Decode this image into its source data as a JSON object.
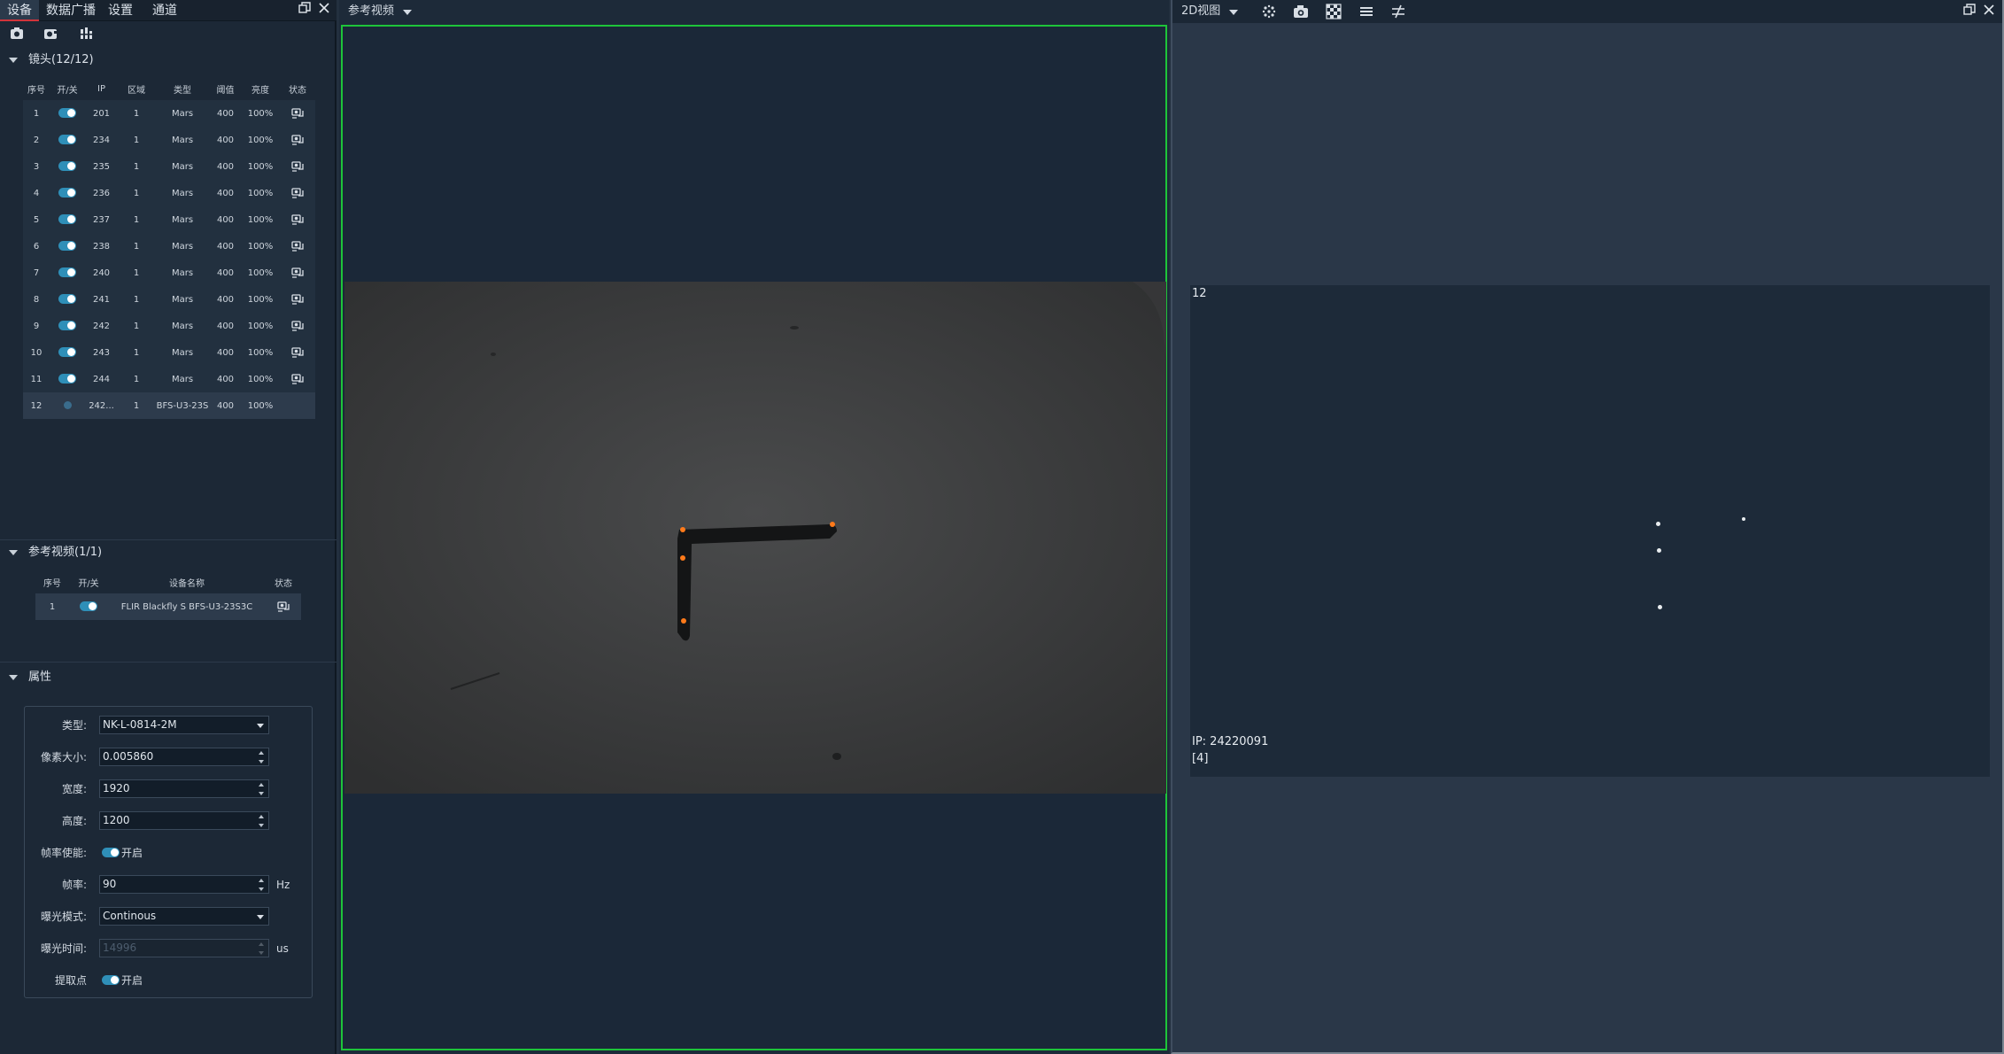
{
  "left_tabs": [
    "设备",
    "数据广播",
    "设置",
    "通道"
  ],
  "cameras": {
    "title": "镜头(12/12)",
    "columns": [
      "序号",
      "开/关",
      "IP",
      "区域",
      "类型",
      "阈值",
      "亮度",
      "状态"
    ],
    "rows": [
      {
        "no": "1",
        "on": true,
        "ip": "201",
        "zone": "1",
        "type": "Mars",
        "threshold": "400",
        "brightness": "100%",
        "status": "connected-icon"
      },
      {
        "no": "2",
        "on": true,
        "ip": "234",
        "zone": "1",
        "type": "Mars",
        "threshold": "400",
        "brightness": "100%",
        "status": "connected-icon"
      },
      {
        "no": "3",
        "on": true,
        "ip": "235",
        "zone": "1",
        "type": "Mars",
        "threshold": "400",
        "brightness": "100%",
        "status": "connected-icon"
      },
      {
        "no": "4",
        "on": true,
        "ip": "236",
        "zone": "1",
        "type": "Mars",
        "threshold": "400",
        "brightness": "100%",
        "status": "connected-icon"
      },
      {
        "no": "5",
        "on": true,
        "ip": "237",
        "zone": "1",
        "type": "Mars",
        "threshold": "400",
        "brightness": "100%",
        "status": "connected-icon"
      },
      {
        "no": "6",
        "on": true,
        "ip": "238",
        "zone": "1",
        "type": "Mars",
        "threshold": "400",
        "brightness": "100%",
        "status": "connected-icon"
      },
      {
        "no": "7",
        "on": true,
        "ip": "240",
        "zone": "1",
        "type": "Mars",
        "threshold": "400",
        "brightness": "100%",
        "status": "connected-icon"
      },
      {
        "no": "8",
        "on": true,
        "ip": "241",
        "zone": "1",
        "type": "Mars",
        "threshold": "400",
        "brightness": "100%",
        "status": "connected-icon"
      },
      {
        "no": "9",
        "on": true,
        "ip": "242",
        "zone": "1",
        "type": "Mars",
        "threshold": "400",
        "brightness": "100%",
        "status": "connected-icon"
      },
      {
        "no": "10",
        "on": true,
        "ip": "243",
        "zone": "1",
        "type": "Mars",
        "threshold": "400",
        "brightness": "100%",
        "status": "connected-icon"
      },
      {
        "no": "11",
        "on": true,
        "ip": "244",
        "zone": "1",
        "type": "Mars",
        "threshold": "400",
        "brightness": "100%",
        "status": "connected-icon"
      },
      {
        "no": "12",
        "on": false,
        "ip": "242...",
        "zone": "1",
        "type": "BFS-U3-23S",
        "threshold": "400",
        "brightness": "100%",
        "status": ""
      }
    ]
  },
  "ref_video_list": {
    "title": "参考视频(1/1)",
    "columns": [
      "序号",
      "开/关",
      "设备名称",
      "状态"
    ],
    "rows": [
      {
        "no": "1",
        "on": true,
        "name": "FLIR Blackfly S BFS-U3-23S3C",
        "status": "connected-icon"
      }
    ]
  },
  "properties": {
    "title": "属性",
    "type_label": "类型:",
    "type_value": "NK-L-0814-2M",
    "pixel_label": "像素大小:",
    "pixel_value": "0.005860",
    "width_label": "宽度:",
    "width_value": "1920",
    "height_label": "高度:",
    "height_value": "1200",
    "fps_enable_label": "帧率使能:",
    "fps_enable_text": "开启",
    "fps_label": "帧率:",
    "fps_value": "90",
    "fps_unit": "Hz",
    "exposure_mode_label": "曝光模式:",
    "exposure_mode_value": "Continous",
    "exposure_time_label": "曝光时间:",
    "exposure_time_value": "14996",
    "exposure_time_unit": "us",
    "extract_label": "提取点",
    "extract_text": "开启"
  },
  "center": {
    "dropdown_label": "参考视频"
  },
  "right": {
    "dropdown_label": "2D视图",
    "view_id": "12",
    "ip_text": "IP: 24220091",
    "count_text": "[4]"
  },
  "colors": {
    "accent_active_border": "#1ec43a",
    "toggle_on": "#2f8fb8",
    "tab_active_underline": "#d2343b"
  }
}
